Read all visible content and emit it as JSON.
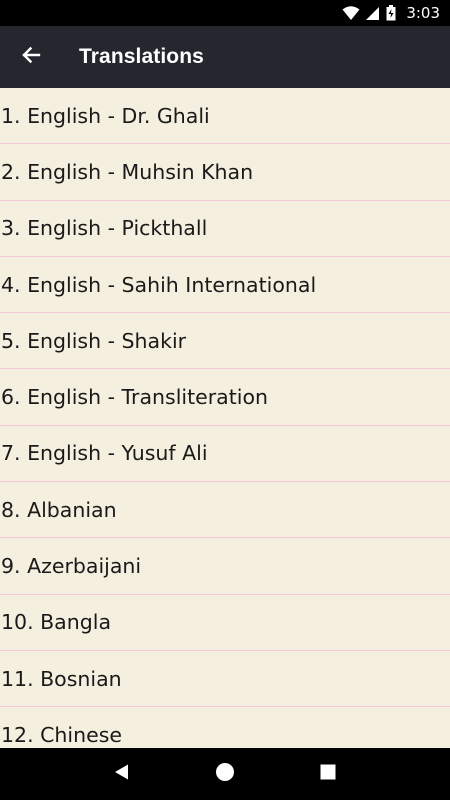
{
  "status_bar": {
    "time": "3:03",
    "icons": [
      "wifi-icon",
      "signal-icon",
      "battery-icon"
    ]
  },
  "app_bar": {
    "title": "Translations",
    "back_icon": "arrow-back-icon"
  },
  "translations": [
    "1. English - Dr. Ghali",
    "2. English - Muhsin Khan",
    "3. English - Pickthall",
    "4. English - Sahih International",
    "5. English - Shakir",
    "6. English - Transliteration",
    "7. English - Yusuf Ali",
    "8. Albanian",
    "9. Azerbaijani",
    "10. Bangla",
    "11. Bosnian",
    "12. Chinese"
  ],
  "nav_bar": {
    "buttons": [
      "back-triangle-icon",
      "home-circle-icon",
      "recents-square-icon"
    ]
  },
  "colors": {
    "app_bar": "#24272e",
    "list_background": "#f5efdf",
    "divider": "#f2c8d8"
  }
}
